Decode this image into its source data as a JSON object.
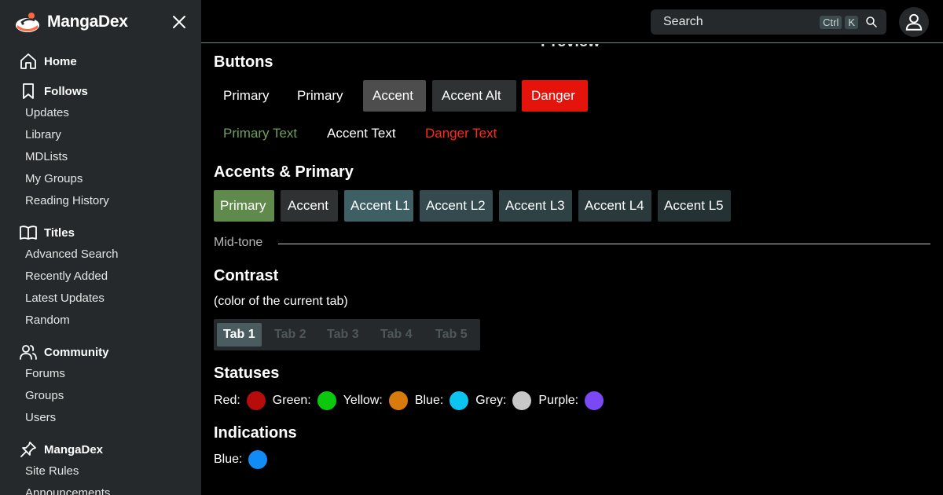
{
  "brand": {
    "name": "MangaDex"
  },
  "search": {
    "placeholder": "Search",
    "shortcut_1": "Ctrl",
    "shortcut_2": "K"
  },
  "sidebar": {
    "sections": [
      {
        "title": "Home",
        "icon": "home-icon",
        "items": []
      },
      {
        "title": "Follows",
        "icon": "bookmark-icon",
        "items": [
          "Updates",
          "Library",
          "MDLists",
          "My Groups",
          "Reading History"
        ]
      },
      {
        "title": "Titles",
        "icon": "book-icon",
        "items": [
          "Advanced Search",
          "Recently Added",
          "Latest Updates",
          "Random"
        ]
      },
      {
        "title": "Community",
        "icon": "users-icon",
        "items": [
          "Forums",
          "Groups",
          "Users"
        ]
      },
      {
        "title": "MangaDex",
        "icon": "pin-icon",
        "items": [
          "Site Rules",
          "Announcements"
        ]
      }
    ]
  },
  "main": {
    "preview_title": "Preview",
    "buttons": {
      "heading": "Buttons",
      "row1": [
        "Primary",
        "Primary",
        "Accent",
        "Accent Alt",
        "Danger"
      ],
      "row2": [
        "Primary Text",
        "Accent Text",
        "Danger Text"
      ]
    },
    "accents": {
      "heading": "Accents & Primary",
      "items": [
        "Primary",
        "Accent",
        "Accent L1",
        "Accent L2",
        "Accent L3",
        "Accent L4",
        "Accent L5"
      ]
    },
    "midtone": "Mid-tone",
    "contrast": {
      "heading": "Contrast",
      "subtitle": "(color of the current tab)",
      "tabs": [
        "Tab 1",
        "Tab 2",
        "Tab 3",
        "Tab 4",
        "Tab 5"
      ],
      "active_tab": 0
    },
    "statuses": {
      "heading": "Statuses",
      "items": [
        {
          "label": "Red:",
          "color": "#b70c0c"
        },
        {
          "label": "Green:",
          "color": "#0cc80c"
        },
        {
          "label": "Yellow:",
          "color": "#d97a0c"
        },
        {
          "label": "Blue:",
          "color": "#0cc4f0"
        },
        {
          "label": "Grey:",
          "color": "#c8c8c8"
        },
        {
          "label": "Purple:",
          "color": "#7b48f5"
        }
      ]
    },
    "indications": {
      "heading": "Indications",
      "items": [
        {
          "label": "Blue:",
          "color": "#118cf5"
        }
      ]
    }
  },
  "colors": {
    "sidebar_bg": "#25292b",
    "primary": "#5f8a4c",
    "primary_text": "#6fa05a",
    "accent": "#4d4d4d",
    "accent_alt": "#2f3233",
    "danger": "#e4140c",
    "danger_text": "#ff2a1a",
    "accent_l1": "#3e5f63",
    "accent_l2": "#344a4e",
    "accent_l3": "#2e4144",
    "accent_l4": "#29393c",
    "accent_l5": "#253234"
  }
}
